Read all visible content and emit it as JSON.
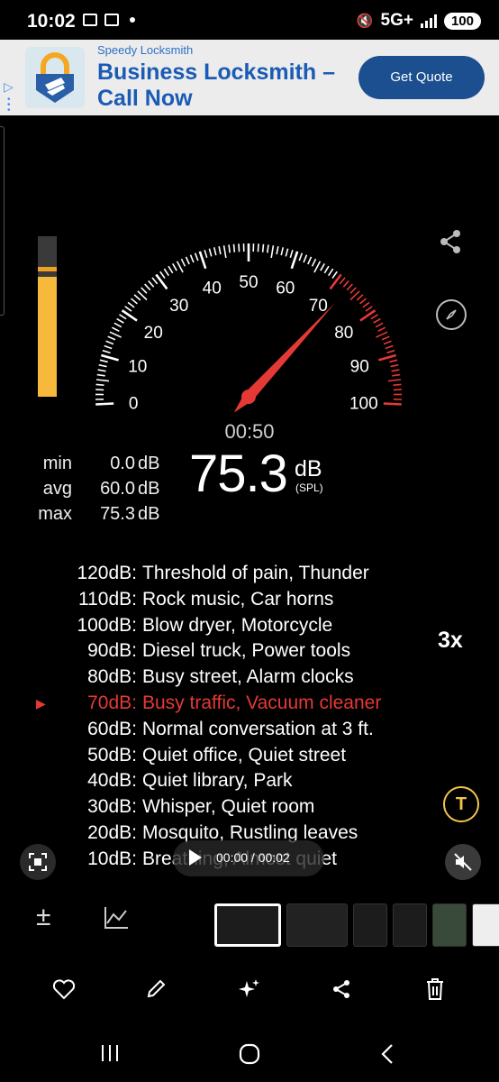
{
  "status_bar": {
    "time": "10:02",
    "network": "5G+",
    "battery": "100"
  },
  "ad": {
    "sponsor": "Speedy Locksmith",
    "title": "Business Locksmith – Call Now",
    "cta": "Get Quote"
  },
  "meter": {
    "level_fraction": 0.75,
    "peak_fraction": 0.78,
    "needle_value": 73,
    "scale_labels": [
      "0",
      "10",
      "20",
      "30",
      "40",
      "50",
      "60",
      "70",
      "80",
      "90",
      "100"
    ],
    "timer": "00:50",
    "reading": "75.3",
    "reading_unit": "dB",
    "reading_sub": "(SPL)",
    "accent_color": "#e53935"
  },
  "stats": [
    {
      "label": "min",
      "value": "0.0",
      "unit": "dB"
    },
    {
      "label": "avg",
      "value": "60.0",
      "unit": "dB"
    },
    {
      "label": "max",
      "value": "75.3",
      "unit": "dB"
    }
  ],
  "reference": [
    {
      "db": "120dB:",
      "desc": "Threshold of pain, Thunder"
    },
    {
      "db": "110dB:",
      "desc": "Rock music, Car horns"
    },
    {
      "db": "100dB:",
      "desc": "Blow dryer, Motorcycle"
    },
    {
      "db": "90dB:",
      "desc": "Diesel truck, Power tools"
    },
    {
      "db": "80dB:",
      "desc": "Busy street, Alarm clocks"
    },
    {
      "db": "70dB:",
      "desc": "Busy traffic, Vacuum cleaner"
    },
    {
      "db": "60dB:",
      "desc": "Normal conversation at 3 ft."
    },
    {
      "db": "50dB:",
      "desc": "Quiet office, Quiet street"
    },
    {
      "db": "40dB:",
      "desc": "Quiet library, Park"
    },
    {
      "db": "30dB:",
      "desc": "Whisper, Quiet room"
    },
    {
      "db": "20dB:",
      "desc": "Mosquito, Rustling leaves"
    },
    {
      "db": "10dB:",
      "desc": "Breathing, Almost quiet"
    }
  ],
  "active_reference_index": 5,
  "zoom": "3x",
  "video": {
    "time": "00:00 / 00:02"
  },
  "icons": {
    "share": "share-icon",
    "compass": "compass-icon",
    "text_detect": "text-detect-icon",
    "mute": "mute-icon",
    "capture": "capture-icon"
  }
}
